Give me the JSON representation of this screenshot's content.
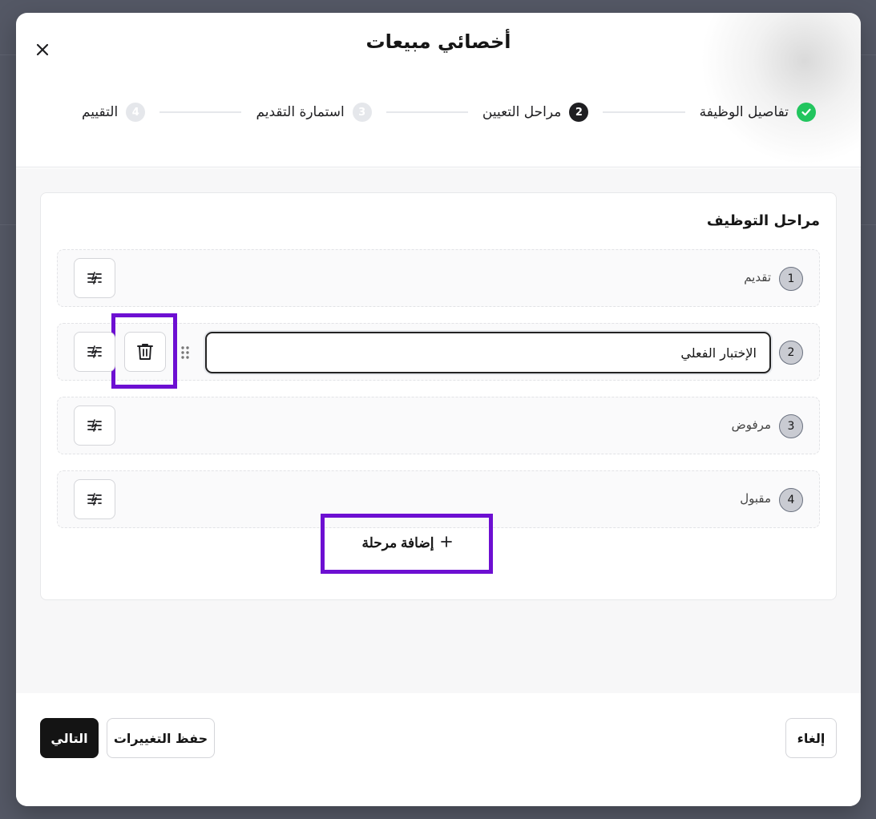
{
  "modal": {
    "title": "أخصائي مبيعات",
    "close_icon": "close-icon"
  },
  "stepper": {
    "steps": [
      {
        "label": "تفاصيل الوظيفة",
        "status": "done",
        "number": ""
      },
      {
        "label": "مراحل التعيين",
        "status": "active",
        "number": "2"
      },
      {
        "label": "استمارة التقديم",
        "status": "pending",
        "number": "3"
      },
      {
        "label": "التقييم",
        "status": "pending",
        "number": "4"
      }
    ]
  },
  "stages_card": {
    "title": "مراحل التوظيف",
    "stages": [
      {
        "number": "1",
        "label": "تقديم"
      },
      {
        "number": "2",
        "input_value": "الإختبار الفعلي",
        "editing": true
      },
      {
        "number": "3",
        "label": "مرفوض"
      },
      {
        "number": "4",
        "label": "مقبول"
      }
    ],
    "add_stage_label": "إضافة مرحلة",
    "add_icon": "plus-icon",
    "settings_icon": "sliders-icon",
    "delete_icon": "trash-icon",
    "drag_icon": "drag-handle-icon"
  },
  "footer": {
    "cancel_label": "إلغاء",
    "save_label": "حفظ التغييرات",
    "next_label": "التالي"
  },
  "colors": {
    "highlight": "#6d0fd2",
    "done_green": "#22c55e",
    "primary_dark": "#141414"
  }
}
